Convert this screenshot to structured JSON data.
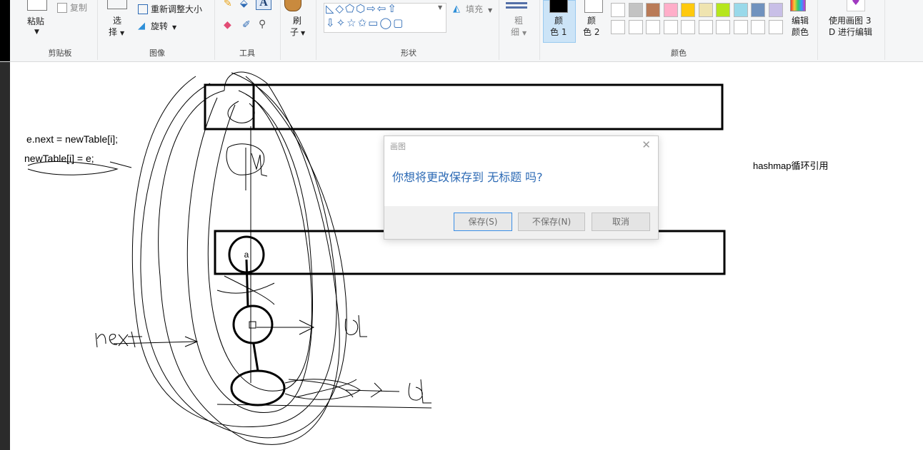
{
  "ribbon": {
    "clipboard": {
      "paste_label_1": "粘贴",
      "copy_label": "复制",
      "group_label": "剪贴板"
    },
    "image": {
      "select_label_1": "选",
      "select_label_2": "择",
      "resize_label": "重新调整大小",
      "rotate_label": "旋转",
      "group_label": "图像"
    },
    "tools": {
      "group_label": "工具",
      "text_glyph": "A"
    },
    "brushes": {
      "label_1": "刷",
      "label_2": "子"
    },
    "shapes": {
      "fill_label": "填充",
      "group_label": "形状"
    },
    "size": {
      "label_1": "粗",
      "label_2": "细"
    },
    "colors": {
      "color1_label_1": "颜",
      "color1_label_2": "色 1",
      "color2_label_1": "颜",
      "color2_label_2": "色 2",
      "edit_label_1": "编辑",
      "edit_label_2": "颜色",
      "group_label": "颜色",
      "palette_row1": [
        "#ffffff",
        "#c3c3c3",
        "#b97a57",
        "#ffaec9",
        "#ffc90e",
        "#efe4b0",
        "#b5e61d",
        "#99d9ea",
        "#7092be",
        "#c8bfe7"
      ],
      "palette_row2": [
        "#ffffff",
        "#ffffff",
        "#ffffff",
        "#ffffff",
        "#ffffff",
        "#ffffff",
        "#ffffff",
        "#ffffff",
        "#ffffff",
        "#ffffff"
      ]
    },
    "paint3d": {
      "label_1": "使用画图 3",
      "label_2": "D 进行编辑"
    }
  },
  "canvas": {
    "code_line1": "e.next = newTable[i];",
    "code_line2": "newTable[i] = e;",
    "side_note": "hashmap循环引用",
    "node_label": "a"
  },
  "dialog": {
    "title": "画图",
    "message": "你想将更改保存到 无标题 吗?",
    "save_label": "保存(S)",
    "dont_save_label": "不保存(N)",
    "cancel_label": "取消"
  }
}
